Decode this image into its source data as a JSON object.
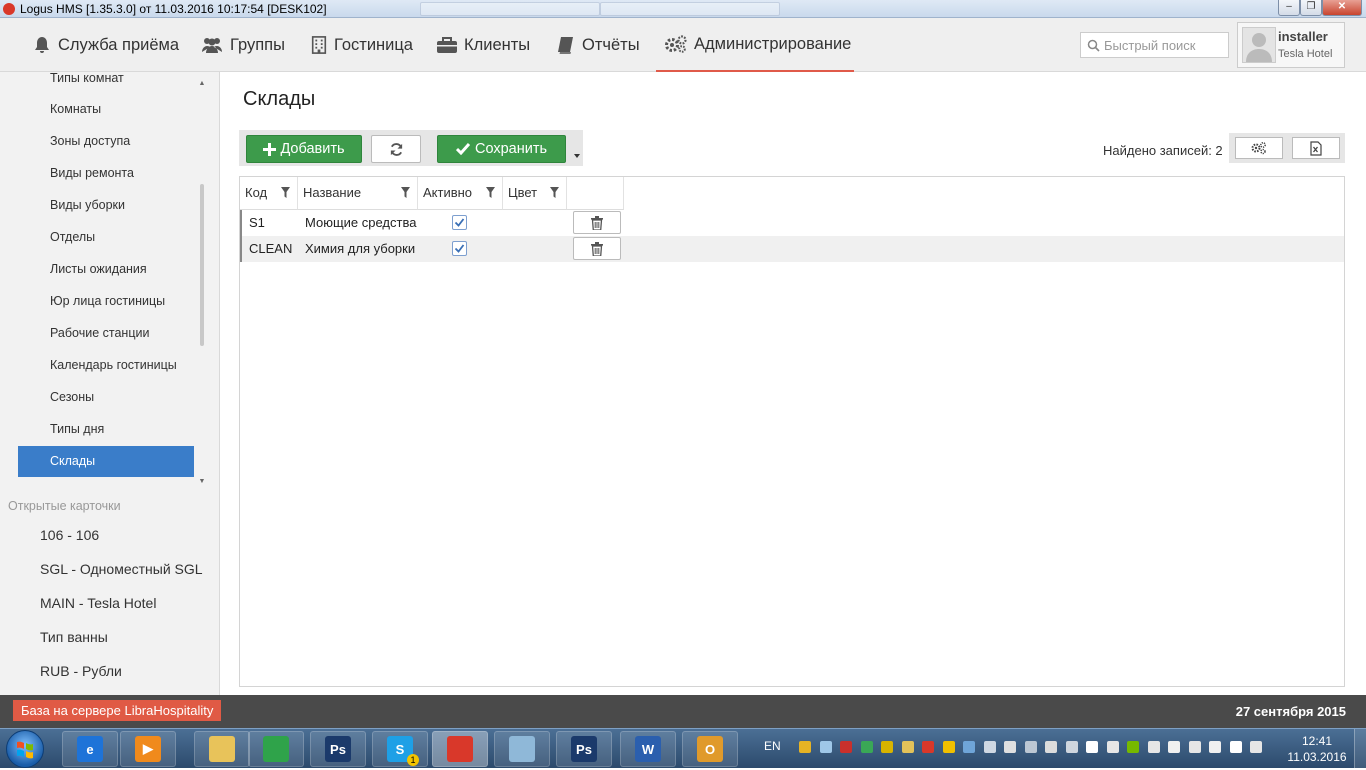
{
  "window": {
    "title": "Logus HMS [1.35.3.0] от 11.03.2016 10:17:54 [DESK102]",
    "minimize": "‒",
    "restore": "❐",
    "close": "✕"
  },
  "nav": {
    "items": [
      {
        "label": "Служба приёма",
        "icon": "bell-icon"
      },
      {
        "label": "Группы",
        "icon": "users-icon"
      },
      {
        "label": "Гостиница",
        "icon": "building-icon"
      },
      {
        "label": "Клиенты",
        "icon": "briefcase-icon"
      },
      {
        "label": "Отчёты",
        "icon": "book-icon"
      },
      {
        "label": "Администрирование",
        "icon": "gears-icon",
        "active": true
      }
    ],
    "search_placeholder": "Быстрый поиск",
    "user": {
      "name": "installer",
      "hotel": "Tesla Hotel"
    }
  },
  "sidebar": {
    "items": [
      {
        "label": "Типы комнат"
      },
      {
        "label": "Комнаты"
      },
      {
        "label": "Зоны доступа"
      },
      {
        "label": "Виды ремонта"
      },
      {
        "label": "Виды уборки"
      },
      {
        "label": "Отделы"
      },
      {
        "label": "Листы ожидания"
      },
      {
        "label": "Юр лица гостиницы"
      },
      {
        "label": "Рабочие станции"
      },
      {
        "label": "Календарь гостиницы"
      },
      {
        "label": "Сезоны"
      },
      {
        "label": "Типы дня"
      },
      {
        "label": "Склады",
        "active": true
      }
    ],
    "open_cards_title": "Открытые карточки",
    "open_cards": [
      {
        "label": "106 - 106"
      },
      {
        "label": "SGL - Одноместный SGL"
      },
      {
        "label": "MAIN - Tesla Hotel"
      },
      {
        "label": "Тип ванны"
      },
      {
        "label": "RUB - Рубли"
      }
    ]
  },
  "main": {
    "title": "Склады",
    "toolbar": {
      "add_label": "Добавить",
      "save_label": "Сохранить"
    },
    "found_label": "Найдено записей: 2",
    "table": {
      "columns": [
        "Код",
        "Название",
        "Активно",
        "Цвет"
      ],
      "rows": [
        {
          "code": "S1",
          "name": "Моющие средства",
          "active": true
        },
        {
          "code": "CLEAN",
          "name": "Химия для уборки",
          "active": true
        }
      ]
    }
  },
  "statusbar": {
    "db_label": "База на сервере LibraHospitality",
    "date": "27 сентября 2015"
  },
  "taskbar": {
    "lang": "EN",
    "time": "12:41",
    "date": "11.03.2016",
    "apps": [
      {
        "name": "ie-icon",
        "glyph": "e",
        "color": "#1e73d8"
      },
      {
        "name": "media-player-icon",
        "glyph": "▶",
        "color": "#f08a1c"
      },
      {
        "name": "explorer-icon",
        "glyph": "",
        "color": "#e8c35a"
      },
      {
        "name": "chrome-icon",
        "glyph": "",
        "color": "#2fa34a"
      },
      {
        "name": "photoshop-icon",
        "glyph": "Ps",
        "color": "#1b3a6b"
      },
      {
        "name": "skype-icon",
        "glyph": "S",
        "color": "#1ea0e6"
      },
      {
        "name": "logus-icon",
        "glyph": "",
        "color": "#d9382a"
      },
      {
        "name": "paint-icon",
        "glyph": "",
        "color": "#8fb8d8"
      },
      {
        "name": "photoshop2-icon",
        "glyph": "Ps",
        "color": "#1b3a6b"
      },
      {
        "name": "word-icon",
        "glyph": "W",
        "color": "#2b5fae"
      },
      {
        "name": "outlook-icon",
        "glyph": "O",
        "color": "#e09a2b"
      }
    ],
    "skype_badge": "1"
  }
}
